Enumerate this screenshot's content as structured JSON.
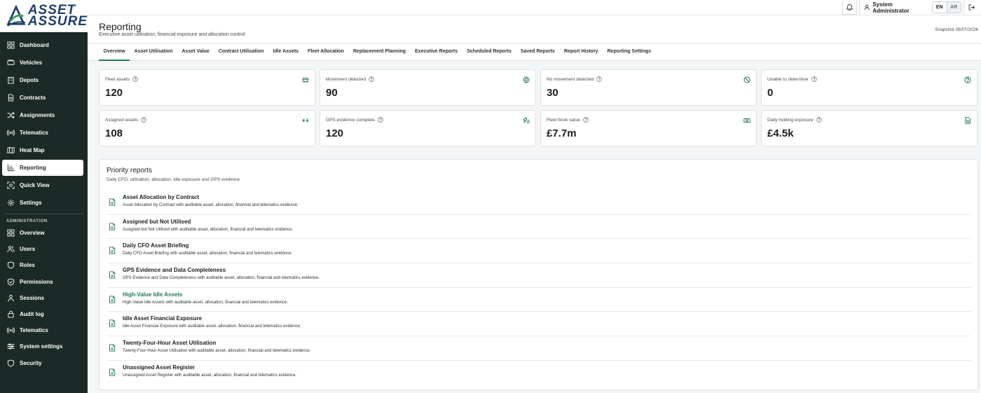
{
  "brand": {
    "name": "ASSET ASSURE",
    "name_line1": "ASSET",
    "name_line2": "ASSURE"
  },
  "sidebar": {
    "items": [
      {
        "label": "Dashboard",
        "icon": "dashboard-icon"
      },
      {
        "label": "Vehicles",
        "icon": "vehicle-icon"
      },
      {
        "label": "Depots",
        "icon": "building-icon"
      },
      {
        "label": "Contracts",
        "icon": "file-icon"
      },
      {
        "label": "Assignments",
        "icon": "shuffle-icon"
      },
      {
        "label": "Telematics",
        "icon": "signal-icon"
      },
      {
        "label": "Heat Map",
        "icon": "map-icon"
      },
      {
        "label": "Reporting",
        "icon": "bar-chart-icon",
        "active": true
      },
      {
        "label": "Quick View",
        "icon": "scan-icon"
      },
      {
        "label": "Settings",
        "icon": "gear-icon"
      }
    ],
    "admin_label": "ADMINISTRATION",
    "admin_items": [
      {
        "label": "Overview",
        "icon": "dashboard-icon"
      },
      {
        "label": "Users",
        "icon": "users-icon"
      },
      {
        "label": "Roles",
        "icon": "shield-icon"
      },
      {
        "label": "Permissions",
        "icon": "shield-check-icon"
      },
      {
        "label": "Sessions",
        "icon": "user-icon"
      },
      {
        "label": "Audit log",
        "icon": "lock-icon"
      },
      {
        "label": "Telematics",
        "icon": "signal-icon"
      },
      {
        "label": "System settings",
        "icon": "sliders-icon"
      },
      {
        "label": "Security",
        "icon": "shield-icon"
      }
    ]
  },
  "topbar": {
    "user_name": "System Administrator",
    "lang_en": "EN",
    "lang_ar": "AR"
  },
  "header": {
    "title": "Reporting",
    "subtitle": "Executive asset utilisation, financial exposure and allocation control",
    "snapshot": "Snapshot 26/07/2026"
  },
  "tabs": [
    {
      "label": "Overview",
      "active": true
    },
    {
      "label": "Asset Utilisation"
    },
    {
      "label": "Asset Value"
    },
    {
      "label": "Contract Utilisation"
    },
    {
      "label": "Idle Assets"
    },
    {
      "label": "Fleet Allocation"
    },
    {
      "label": "Replacement Planning"
    },
    {
      "label": "Executive Reports"
    },
    {
      "label": "Scheduled Reports"
    },
    {
      "label": "Saved Reports"
    },
    {
      "label": "Report History"
    },
    {
      "label": "Reporting Settings"
    }
  ],
  "kpis": [
    {
      "label": "Fleet assets",
      "value": "120",
      "icon": "truck-icon"
    },
    {
      "label": "Movement detected",
      "value": "90",
      "icon": "target-icon"
    },
    {
      "label": "No movement detected",
      "value": "30",
      "icon": "no-signal-icon"
    },
    {
      "label": "Unable to determine",
      "value": "0",
      "icon": "question-icon"
    },
    {
      "label": "Assigned assets",
      "value": "108",
      "icon": "link-icon"
    },
    {
      "label": "GPS evidence complete",
      "value": "120",
      "icon": "satellite-icon"
    },
    {
      "label": "Fleet book value",
      "value": "£7.7m",
      "icon": "banknote-icon"
    },
    {
      "label": "Daily holding exposure",
      "value": "£4.5k",
      "icon": "document-icon"
    }
  ],
  "reports": {
    "title": "Priority reports",
    "subtitle": "Daily CFO, utilisation, allocation, idle exposure and GPS evidence",
    "items": [
      {
        "name": "Asset Allocation by Contract",
        "desc": "Asset Allocation by Contract with auditable asset, allocation, financial and telematics evidence."
      },
      {
        "name": "Assigned but Not Utilised",
        "desc": "Assigned but Not Utilised with auditable asset, allocation, financial and telematics evidence."
      },
      {
        "name": "Daily CFO Asset Briefing",
        "desc": "Daily CFO Asset Briefing with auditable asset, allocation, financial and telematics evidence."
      },
      {
        "name": "GPS Evidence and Data Completeness",
        "desc": "GPS Evidence and Data Completeness with auditable asset, allocation, financial and telematics evidence."
      },
      {
        "name": "High-Value Idle Assets",
        "desc": "High-Value Idle Assets with auditable asset, allocation, financial and telematics evidence.",
        "highlight": true
      },
      {
        "name": "Idle Asset Financial Exposure",
        "desc": "Idle Asset Financial Exposure with auditable asset, allocation, financial and telematics evidence."
      },
      {
        "name": "Twenty-Four-Hour Asset Utilisation",
        "desc": "Twenty-Four-Hour Asset Utilisation with auditable asset, allocation, financial and telematics evidence."
      },
      {
        "name": "Unassigned Asset Register",
        "desc": "Unassigned Asset Register with auditable asset, allocation, financial and telematics evidence."
      }
    ]
  },
  "colors": {
    "sidebar": "#1b2a26",
    "accent": "#1f7a55",
    "brand_blue": "#1b3f6b",
    "brand_green": "#3aa35a"
  }
}
